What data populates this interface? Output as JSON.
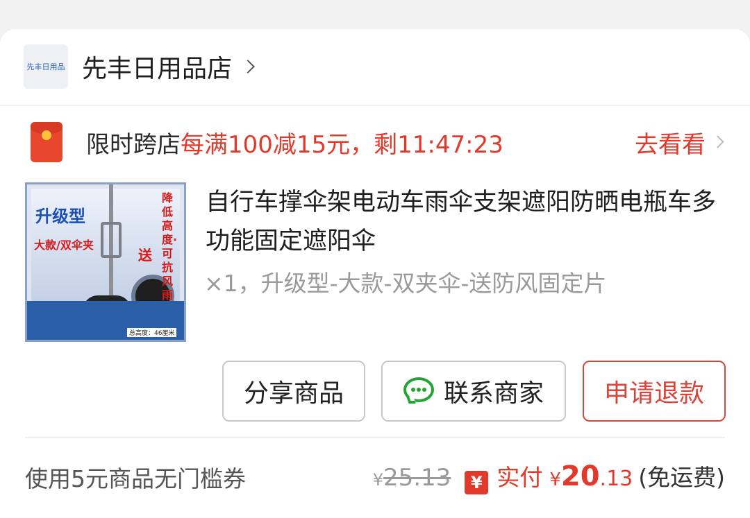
{
  "store": {
    "logo_text": "先丰日用品",
    "name": "先丰日用品店"
  },
  "promo": {
    "label": "限时跨店",
    "rule": "每满100减15元，剩11:47:23",
    "action": "去看看"
  },
  "product": {
    "image_text": {
      "title": "升级型",
      "subtitle": "大款/双伞夹",
      "vertical": "降低高度·可抗风雨",
      "gift": "送",
      "note": "总高度：46厘米"
    },
    "title": "自行车撑伞架电动车雨伞支架遮阳防晒电瓶车多功能固定遮阳伞",
    "spec": "×1，升级型-大款-双夹伞-送防风固定片"
  },
  "buttons": {
    "share": "分享商品",
    "contact": "联系商家",
    "refund": "申请退款"
  },
  "footer": {
    "coupon": "使用5元商品无门槛券",
    "original_symbol": "¥",
    "original_price": "25.13",
    "paid_badge": "¥",
    "paid_label": "实付",
    "paid_symbol": "¥",
    "paid_integer": "20",
    "paid_decimal": ".13",
    "freight": "(免运费)"
  },
  "colors": {
    "accent": "#e2392b",
    "wechat": "#24a533"
  }
}
